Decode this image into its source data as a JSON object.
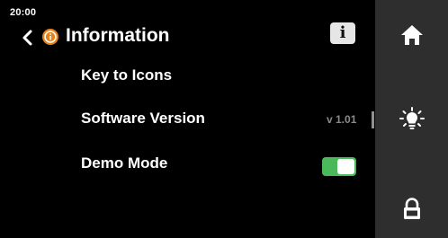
{
  "status": {
    "time": "20:00"
  },
  "header": {
    "title": "Information",
    "back_icon": "chevron-left-icon",
    "badge_icon": "info-circle-icon",
    "info_button_label": "i"
  },
  "menu": {
    "items": [
      {
        "label": "Key to Icons"
      },
      {
        "label": "Software Version",
        "value": "v 1.01"
      },
      {
        "label": "Demo Mode",
        "toggle_on": true
      }
    ]
  },
  "sidebar": {
    "items": [
      "home-icon",
      "light-bulb-icon",
      "lock-icon"
    ]
  },
  "colors": {
    "accent_orange": "#e8801a",
    "toggle_green": "#4cb85c",
    "sidebar_bg": "#2e2e2e",
    "background": "#000000"
  }
}
